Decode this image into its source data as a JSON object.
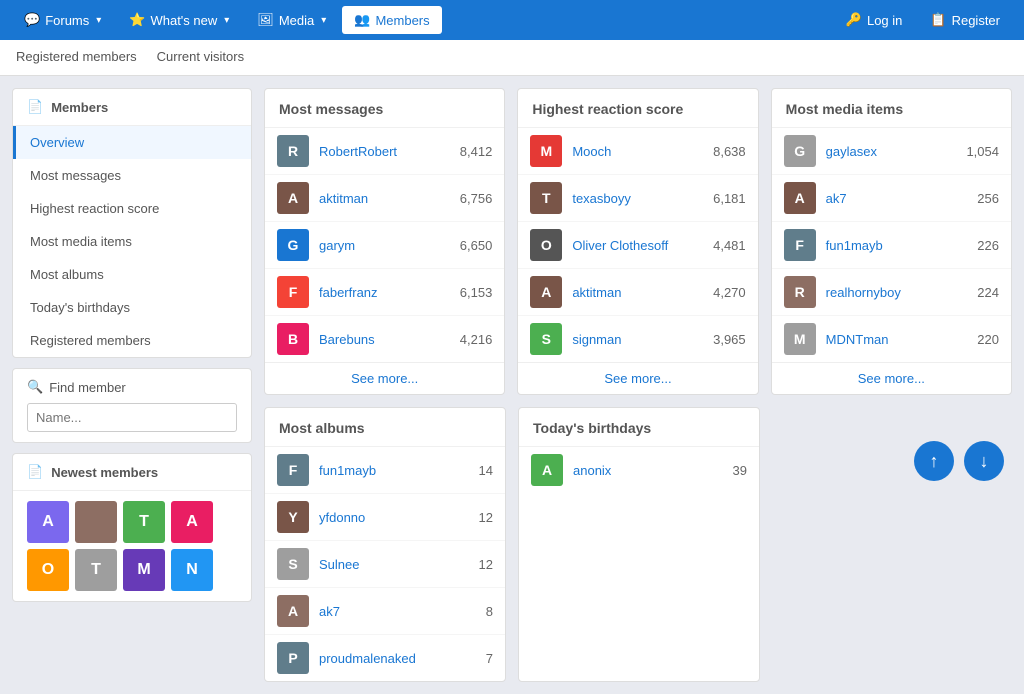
{
  "nav": {
    "items": [
      {
        "label": "Forums",
        "icon": "forum-icon",
        "hasDropdown": true,
        "active": false
      },
      {
        "label": "What's new",
        "icon": "new-icon",
        "hasDropdown": true,
        "active": false
      },
      {
        "label": "Media",
        "icon": "media-icon",
        "hasDropdown": true,
        "active": false
      },
      {
        "label": "Members",
        "icon": "members-icon",
        "hasDropdown": false,
        "active": true
      }
    ],
    "login_label": "Log in",
    "register_label": "Register"
  },
  "subnav": {
    "items": [
      "Registered members",
      "Current visitors"
    ]
  },
  "sidebar": {
    "members_header": "Members",
    "menu_items": [
      {
        "label": "Overview",
        "active": true
      },
      {
        "label": "Most messages",
        "active": false
      },
      {
        "label": "Highest reaction score",
        "active": false
      },
      {
        "label": "Most media items",
        "active": false
      },
      {
        "label": "Most albums",
        "active": false
      },
      {
        "label": "Today's birthdays",
        "active": false
      },
      {
        "label": "Registered members",
        "active": false
      }
    ],
    "find_member_title": "Find member",
    "find_member_placeholder": "Name...",
    "newest_members_title": "Newest members",
    "newest_avatars": [
      {
        "letter": "A",
        "color": "#7b68ee"
      },
      {
        "letter": "",
        "color": "#8d6e63",
        "isPhoto": true
      },
      {
        "letter": "T",
        "color": "#4caf50"
      },
      {
        "letter": "A",
        "color": "#e91e63"
      },
      {
        "letter": "O",
        "color": "#ff9800"
      },
      {
        "letter": "T",
        "color": "#9e9e9e"
      },
      {
        "letter": "M",
        "color": "#673ab7"
      },
      {
        "letter": "N",
        "color": "#2196f3"
      }
    ]
  },
  "most_messages": {
    "title": "Most messages",
    "rows": [
      {
        "name": "RobertRobert",
        "count": "8,412",
        "color": "#607d8b"
      },
      {
        "name": "aktitman",
        "count": "6,756",
        "color": "#795548"
      },
      {
        "name": "garym",
        "count": "6,650",
        "color": "#1976d2",
        "letter": "G"
      },
      {
        "name": "faberfranz",
        "count": "6,153",
        "color": "#f44336",
        "letter": "F"
      },
      {
        "name": "Barebuns",
        "count": "4,216",
        "color": "#e91e63"
      }
    ],
    "see_more": "See more..."
  },
  "highest_reaction": {
    "title": "Highest reaction score",
    "rows": [
      {
        "name": "Mooch",
        "count": "8,638",
        "color": "#e53935",
        "letter": "M"
      },
      {
        "name": "texasboyy",
        "count": "6,181",
        "color": "#795548"
      },
      {
        "name": "Oliver Clothesoff",
        "count": "4,481",
        "color": "#555"
      },
      {
        "name": "aktitman",
        "count": "4,270",
        "color": "#795548"
      },
      {
        "name": "signman",
        "count": "3,965",
        "color": "#4caf50",
        "letter": "S"
      }
    ],
    "see_more": "See more..."
  },
  "most_media": {
    "title": "Most media items",
    "rows": [
      {
        "name": "gaylasex",
        "count": "1,054",
        "color": "#9e9e9e"
      },
      {
        "name": "ak7",
        "count": "256",
        "color": "#795548"
      },
      {
        "name": "fun1mayb",
        "count": "226",
        "color": "#607d8b"
      },
      {
        "name": "realhornyboy",
        "count": "224",
        "color": "#8d6e63"
      },
      {
        "name": "MDNTman",
        "count": "220",
        "color": "#9e9e9e"
      }
    ],
    "see_more": "See more..."
  },
  "most_albums": {
    "title": "Most albums",
    "rows": [
      {
        "name": "fun1mayb",
        "count": "14",
        "color": "#607d8b"
      },
      {
        "name": "yfdonno",
        "count": "12",
        "color": "#795548"
      },
      {
        "name": "Sulnee",
        "count": "12",
        "color": "#9e9e9e"
      },
      {
        "name": "ak7",
        "count": "8",
        "color": "#8d6e63"
      },
      {
        "name": "proudmalenaked",
        "count": "7",
        "color": "#607d8b"
      }
    ]
  },
  "birthdays": {
    "title": "Today's birthdays",
    "rows": [
      {
        "name": "anonix",
        "count": "39",
        "color": "#4caf50",
        "letter": "A"
      }
    ]
  }
}
